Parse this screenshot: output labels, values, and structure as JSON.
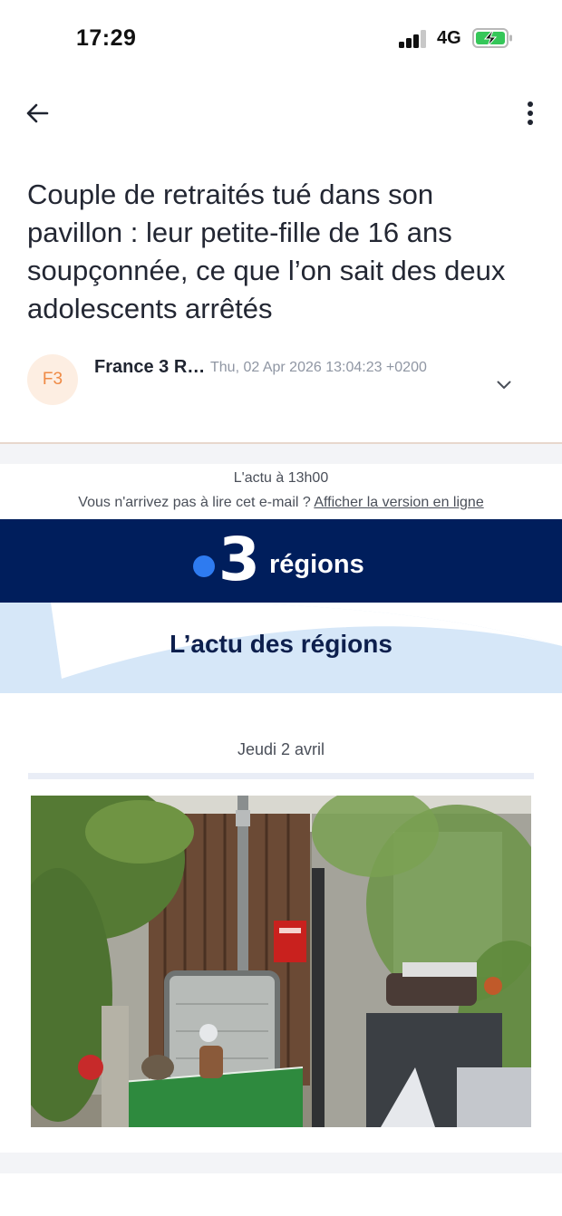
{
  "status_bar": {
    "time": "17:29",
    "network": "4G",
    "icons": [
      "signal-bars-icon",
      "battery-charging-icon"
    ]
  },
  "toolbar": {
    "back_icon": "arrow-left-icon",
    "more_icon": "more-vertical-icon"
  },
  "email": {
    "subject": "Couple de retraités tué dans son pavillon : leur petite-fille de 16 ans soupçonnée, ce que l’on sait des deux adolescents arrêtés",
    "sender": {
      "avatar_initials": "F3",
      "name": "France 3 R…",
      "date": "Thu, 02 Apr 2026 13:04:23 +0200",
      "expand_icon": "chevron-down-icon"
    }
  },
  "newsletter": {
    "preheader": {
      "title": "L'actu à 13h00",
      "prompt": "Vous n'arrivez pas à lire cet e-mail ?",
      "link": "Afficher la version en ligne"
    },
    "brand": {
      "numeral": "3",
      "word": "régions"
    },
    "hero_title": "L’actu des régions",
    "date": "Jeudi 2 avril",
    "image_icon": "news-photo-garden-chair"
  },
  "colors": {
    "brand_navy": "#001e5c",
    "brand_blue_dot": "#2e7bf0",
    "hero_light_blue": "#d6e7f8",
    "avatar_bg": "#fdeee2",
    "avatar_text": "#ef8a45"
  }
}
